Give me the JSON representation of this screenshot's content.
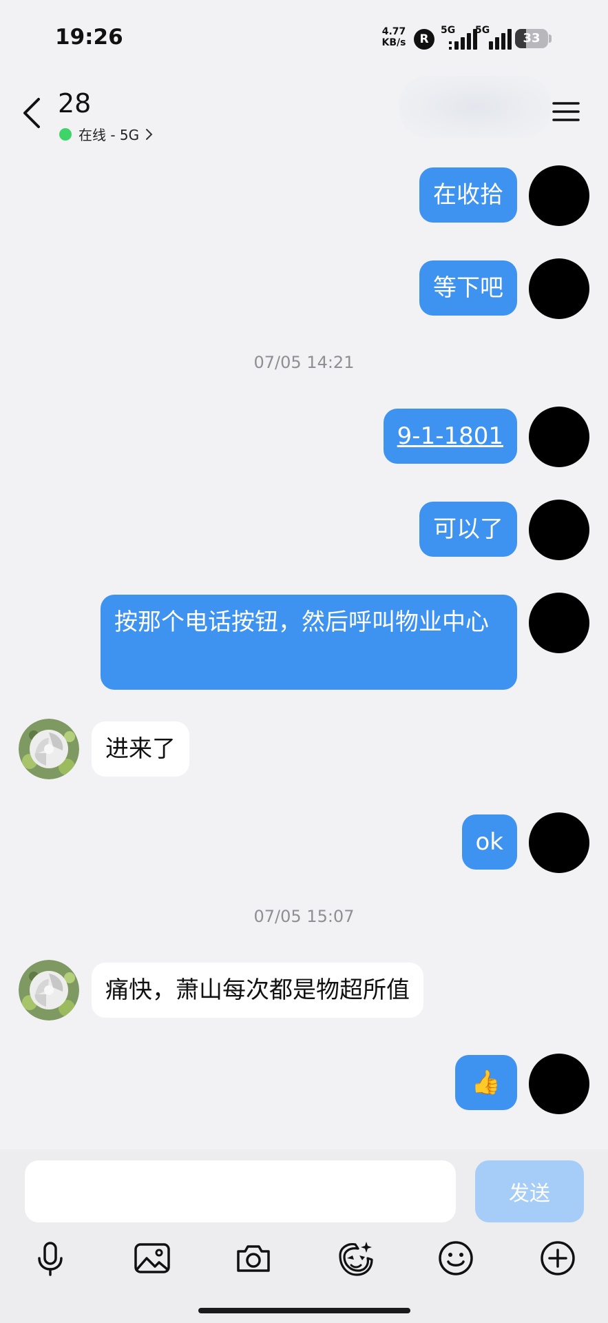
{
  "status_bar": {
    "time": "19:26",
    "net_speed_value": "4.77",
    "net_speed_unit": "KB/s",
    "roaming": "R",
    "sim1": "5G",
    "sim2": "5G",
    "battery": "33",
    "battery_level": 0.33
  },
  "header": {
    "title": "28",
    "status": "在线 - 5G"
  },
  "messages": [
    {
      "from": "self",
      "text": "在收拾"
    },
    {
      "from": "self",
      "text": "等下吧"
    },
    {
      "timestamp": "07/05 14:21"
    },
    {
      "from": "self",
      "text": "9-1-1801",
      "link": true
    },
    {
      "from": "self",
      "text": "可以了"
    },
    {
      "from": "self",
      "text": "按那个电话按钮，然后呼叫物业中心"
    },
    {
      "from": "other",
      "text": "进来了"
    },
    {
      "from": "self",
      "text": "ok"
    },
    {
      "timestamp": "07/05 15:07"
    },
    {
      "from": "other",
      "text": "痛快，萧山每次都是物超所值"
    },
    {
      "from": "self",
      "emoji": "👍"
    }
  ],
  "input": {
    "value": "",
    "send_label": "发送"
  },
  "toolbar": [
    "microphone-icon",
    "image-icon",
    "camera-icon",
    "sticker-icon",
    "emoji-icon",
    "plus-icon"
  ]
}
